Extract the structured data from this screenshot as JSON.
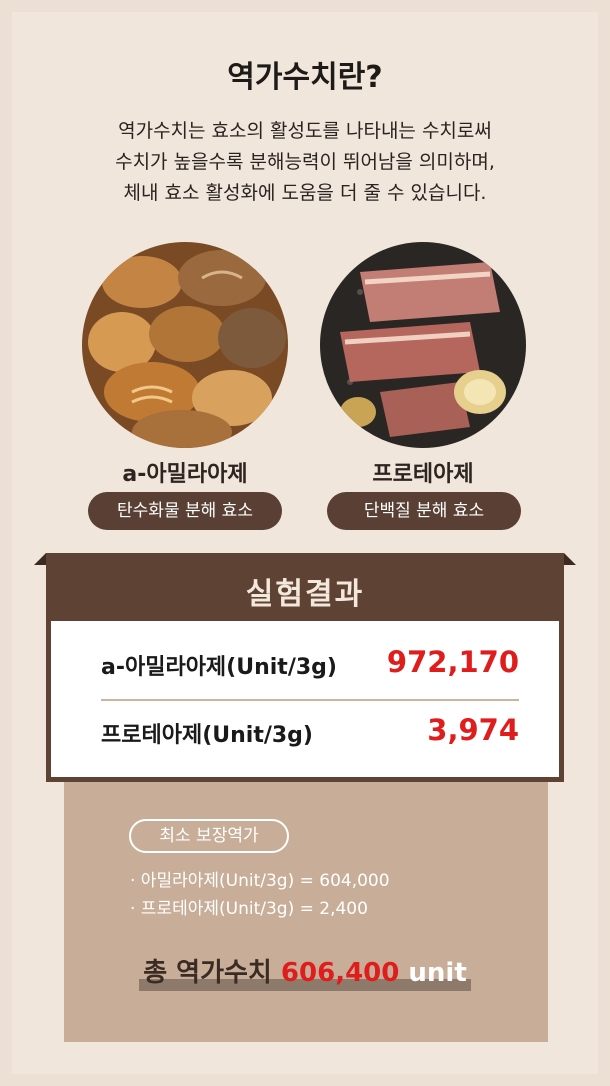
{
  "title": "역가수치란?",
  "intro": {
    "line1": "역가수치는 효소의 활성도를 나타내는 수치로써",
    "line2": "수치가 높을수록 분해능력이 뛰어남을 의미하며,",
    "line3": "체내 효소 활성화에 도움을 더 줄 수 있습니다."
  },
  "enzymes": [
    {
      "name": "a-아밀라아제",
      "type": "탄수화물 분해 효소",
      "image": "bread-image"
    },
    {
      "name": "프로테아제",
      "type": "단백질 분해 효소",
      "image": "grilled-meat-image"
    }
  ],
  "results": {
    "title": "실험결과",
    "rows": [
      {
        "label": "a-아밀라아제(Unit/3g)",
        "value": "972,170"
      },
      {
        "label": "프로테아제(Unit/3g)",
        "value": "3,974"
      }
    ]
  },
  "guarantee": {
    "badge": "최소 보장역가",
    "items": [
      "· 아밀라아제(Unit/3g) = 604,000",
      "· 프로테아제(Unit/3g) = 2,400"
    ]
  },
  "total": {
    "label": "총 역가수치",
    "value": "606,400",
    "unit": "unit"
  },
  "colors": {
    "background": "#f1e6dc",
    "brown_dark": "#5e4233",
    "accent_red": "#e01d1d",
    "tan": "#c8ae98"
  }
}
